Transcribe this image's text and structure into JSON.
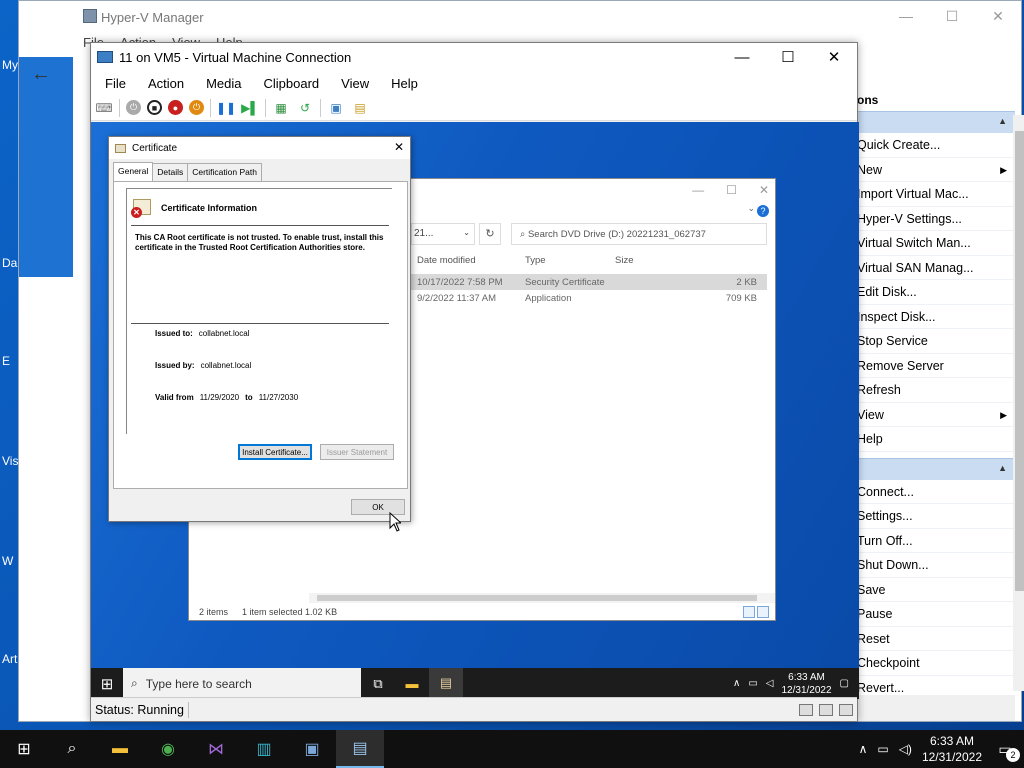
{
  "host": {
    "desktop_labels": [
      "My",
      "Da",
      "E",
      "Vis",
      "W",
      "Art"
    ],
    "taskbar": {
      "time": "6:33 AM",
      "date": "12/31/2022",
      "notifications": "2"
    }
  },
  "hyperv": {
    "title": "Hyper-V Manager",
    "menu": [
      "File",
      "Action",
      "View",
      "Help"
    ],
    "actions_header": "ons",
    "actions": [
      {
        "label": "Quick Create...",
        "sub": false
      },
      {
        "label": "New",
        "sub": true
      },
      {
        "label": "Import Virtual Mac...",
        "sub": false
      },
      {
        "label": "Hyper-V Settings...",
        "sub": false
      },
      {
        "label": "Virtual Switch Man...",
        "sub": false
      },
      {
        "label": "Virtual SAN Manag...",
        "sub": false
      },
      {
        "label": "Edit Disk...",
        "sub": false
      },
      {
        "label": "Inspect Disk...",
        "sub": false
      },
      {
        "label": "Stop Service",
        "sub": false
      },
      {
        "label": "Remove Server",
        "sub": false
      },
      {
        "label": "Refresh",
        "sub": false
      },
      {
        "label": "View",
        "sub": true
      },
      {
        "label": "Help",
        "sub": false
      }
    ],
    "vm_actions": [
      "Connect...",
      "Settings...",
      "Turn Off...",
      "Shut Down...",
      "Save",
      "Pause",
      "Reset",
      "Checkpoint",
      "Revert..."
    ]
  },
  "vm": {
    "title": "11 on VM5 - Virtual Machine Connection",
    "menu": [
      "File",
      "Action",
      "Media",
      "Clipboard",
      "View",
      "Help"
    ],
    "status": "Status: Running"
  },
  "guest": {
    "search_placeholder": "Type here to search",
    "time": "6:33 AM",
    "date": "12/31/2022"
  },
  "explorer": {
    "path_fragment": "21...",
    "search_placeholder": "Search DVD Drive (D:) 20221231_062737",
    "columns": [
      "Date modified",
      "Type",
      "Size"
    ],
    "rows": [
      {
        "date": "10/17/2022 7:58 PM",
        "type": "Security Certificate",
        "size": "2 KB",
        "selected": true
      },
      {
        "date": "9/2/2022 11:37 AM",
        "type": "Application",
        "size": "709 KB",
        "selected": false
      }
    ],
    "status_items": "2 items",
    "status_selected": "1 item selected  1.02 KB"
  },
  "certificate": {
    "title": "Certificate",
    "tabs": [
      "General",
      "Details",
      "Certification Path"
    ],
    "info_heading": "Certificate Information",
    "message": "This CA Root certificate is not trusted. To enable trust, install this certificate in the Trusted Root Certification Authorities store.",
    "issued_to_label": "Issued to:",
    "issued_to": "collabnet.local",
    "issued_by_label": "Issued by:",
    "issued_by": "collabnet.local",
    "valid_from_label": "Valid from",
    "valid_from": "11/29/2020",
    "valid_to_label": "to",
    "valid_to": "11/27/2030",
    "install_button": "Install Certificate...",
    "issuer_button": "Issuer Statement",
    "ok_button": "OK"
  }
}
